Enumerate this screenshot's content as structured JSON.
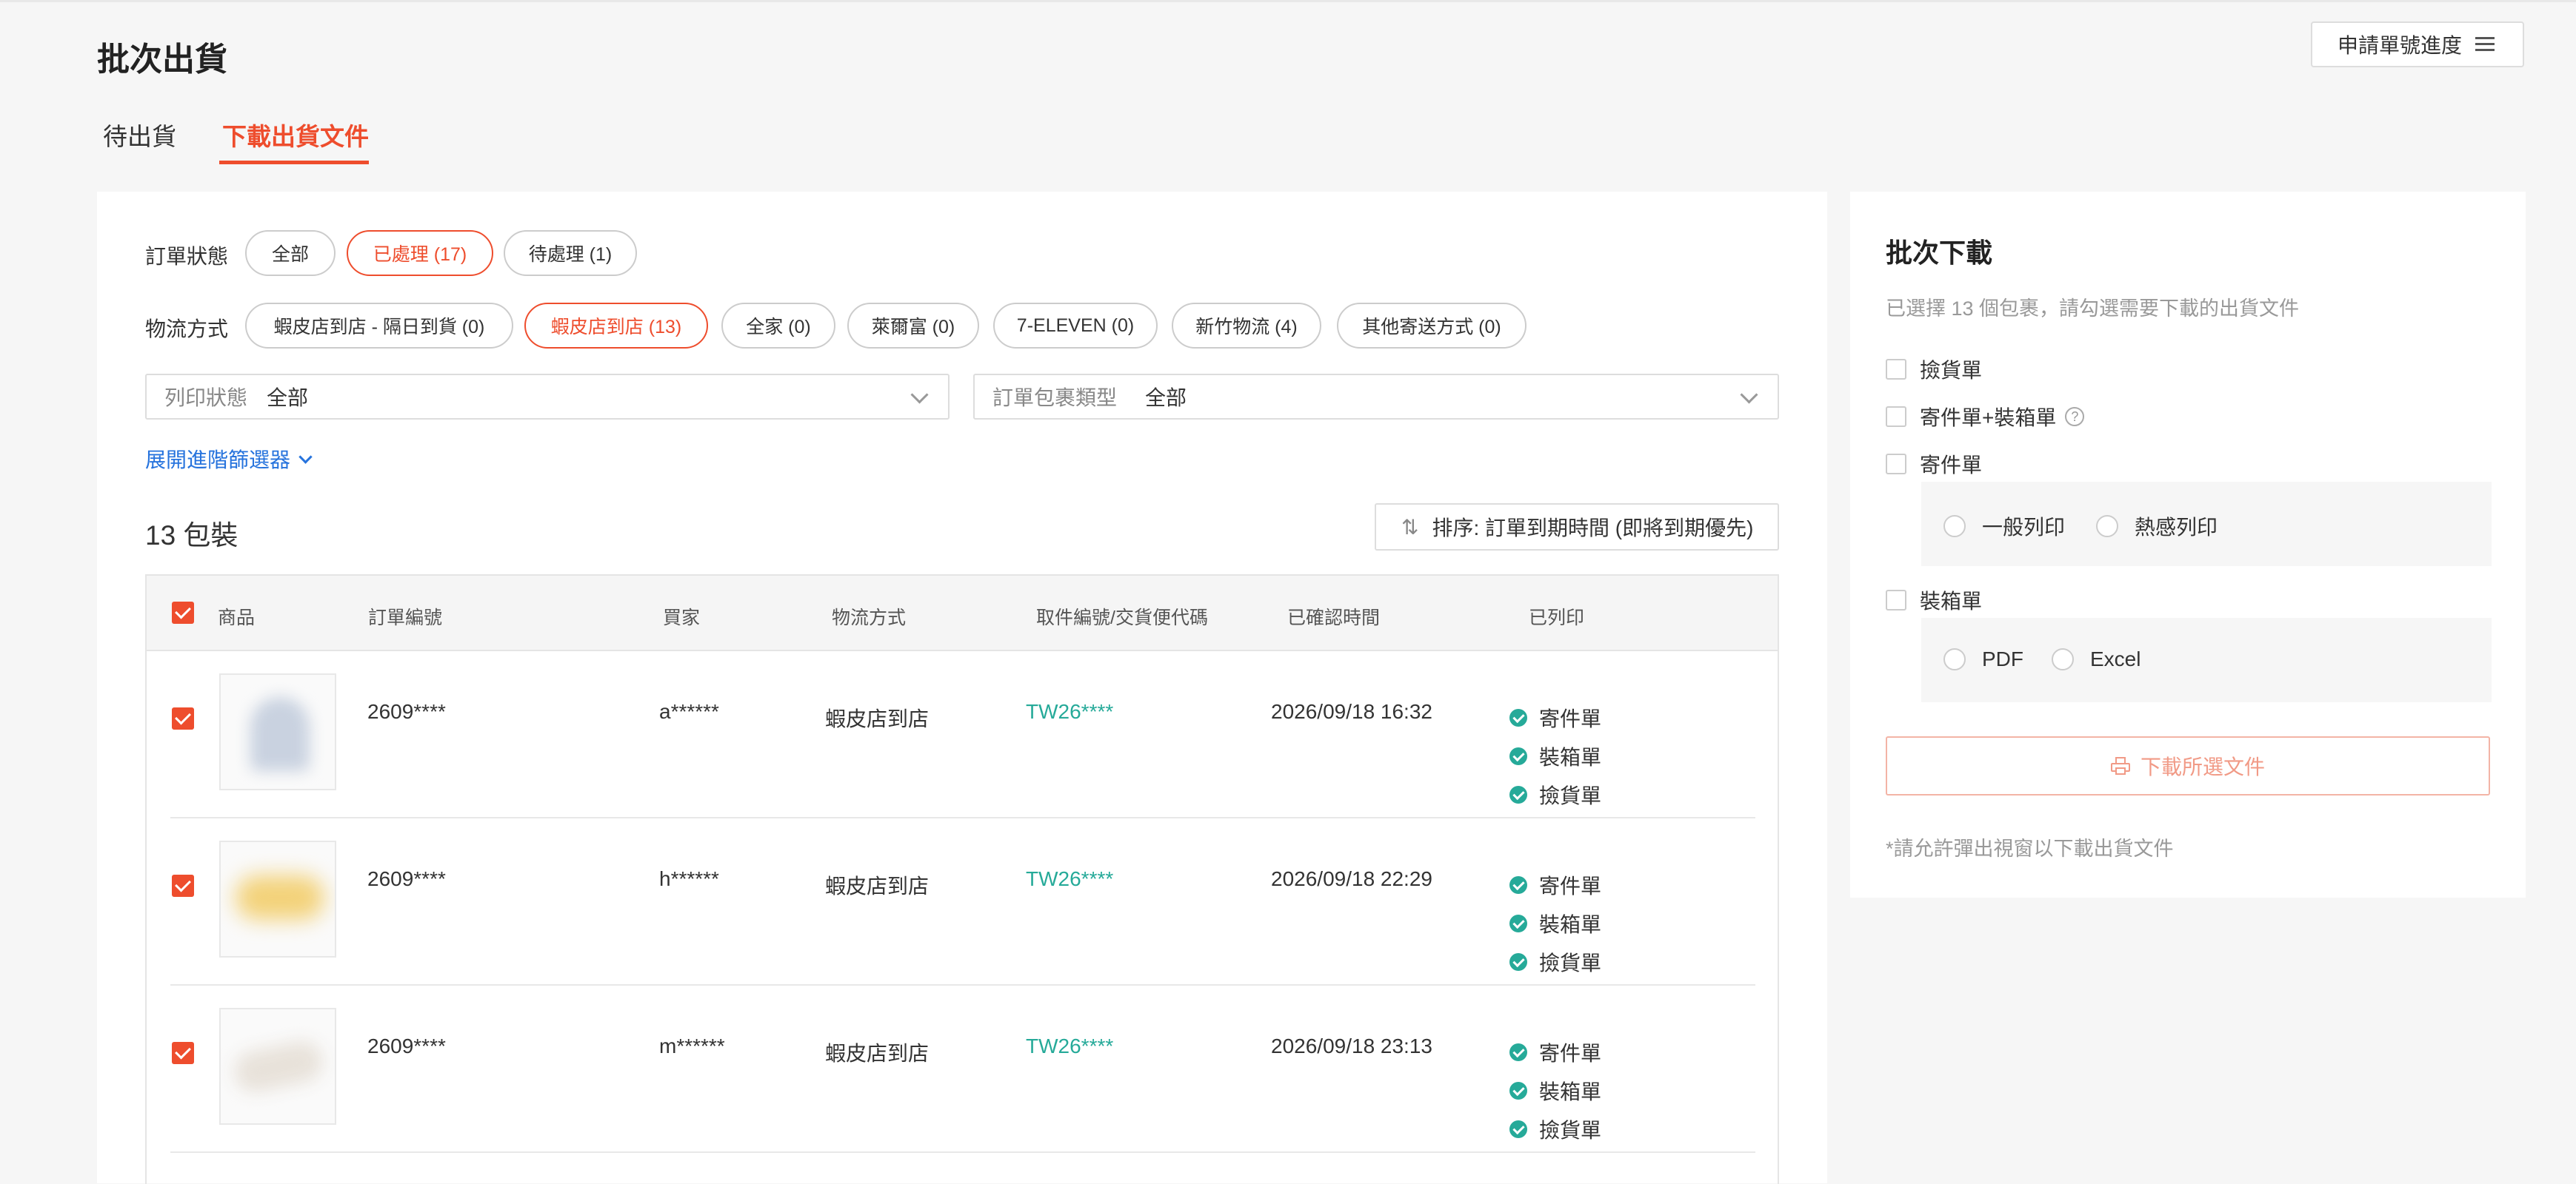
{
  "header": {
    "title": "批次出貨",
    "progress_button": "申請單號進度"
  },
  "tabs": [
    {
      "label": "待出貨",
      "active": false
    },
    {
      "label": "下載出貨文件",
      "active": true
    }
  ],
  "filters": {
    "order_status": {
      "label": "訂單狀態",
      "options": [
        {
          "label": "全部",
          "active": false
        },
        {
          "label": "已處理 (17)",
          "active": true
        },
        {
          "label": "待處理 (1)",
          "active": false
        }
      ]
    },
    "shipping": {
      "label": "物流方式",
      "options": [
        {
          "label": "蝦皮店到店 - 隔日到貨 (0)",
          "active": false
        },
        {
          "label": "蝦皮店到店 (13)",
          "active": true
        },
        {
          "label": "全家 (0)",
          "active": false
        },
        {
          "label": "萊爾富 (0)",
          "active": false
        },
        {
          "label": "7-ELEVEN (0)",
          "active": false
        },
        {
          "label": "新竹物流 (4)",
          "active": false
        },
        {
          "label": "其他寄送方式 (0)",
          "active": false
        }
      ]
    },
    "print_status": {
      "label": "列印狀態",
      "value": "全部"
    },
    "package_type": {
      "label": "訂單包裹類型",
      "value": "全部"
    },
    "advanced_link": "展開進階篩選器"
  },
  "list": {
    "count_title": "13 包裝",
    "sort_label": "排序: 訂單到期時間 (即將到期優先)",
    "columns": [
      "商品",
      "訂單編號",
      "買家",
      "物流方式",
      "取件編號/交貨便代碼",
      "已確認時間",
      "已列印"
    ],
    "rows": [
      {
        "order_id": "2609****",
        "buyer": "a******",
        "shipping": "蝦皮店到店",
        "tracking": "TW26****",
        "confirmed": "2026/09/18 16:32",
        "printed": [
          "寄件單",
          "裝箱單",
          "撿貨單"
        ]
      },
      {
        "order_id": "2609****",
        "buyer": "h******",
        "shipping": "蝦皮店到店",
        "tracking": "TW26****",
        "confirmed": "2026/09/18 22:29",
        "printed": [
          "寄件單",
          "裝箱單",
          "撿貨單"
        ]
      },
      {
        "order_id": "2609****",
        "buyer": "m******",
        "shipping": "蝦皮店到店",
        "tracking": "TW26****",
        "confirmed": "2026/09/18 23:13",
        "printed": [
          "寄件單",
          "裝箱單",
          "撿貨單"
        ]
      }
    ]
  },
  "side": {
    "title": "批次下載",
    "hint": "已選擇 13 個包裹，請勾選需要下載的出貨文件",
    "options": {
      "pick_list": "撿貨單",
      "waybill_packing": "寄件單+裝箱單",
      "waybill": "寄件單",
      "packing": "裝箱單"
    },
    "waybill_modes": [
      "一般列印",
      "熱感列印"
    ],
    "packing_formats": [
      "PDF",
      "Excel"
    ],
    "download_button": "下載所選文件",
    "note": "*請允許彈出視窗以下載出貨文件",
    "help_glyph": "?"
  },
  "colors": {
    "accent": "#ee4d2d",
    "success": "#26aa99",
    "link": "#2673dd"
  }
}
